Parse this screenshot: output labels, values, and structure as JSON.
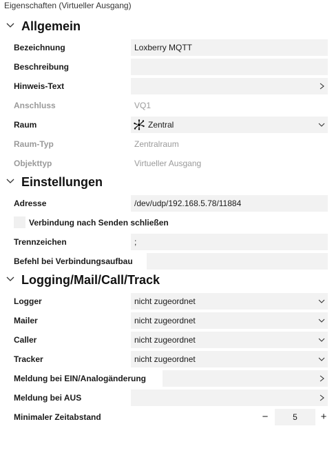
{
  "window_title": "Eigenschaften (Virtueller Ausgang)",
  "sections": {
    "allgemein": "Allgemein",
    "einstellungen": "Einstellungen",
    "logging": "Logging/Mail/Call/Track"
  },
  "allgemein": {
    "bezeichnung": {
      "label": "Bezeichnung",
      "value": "Loxberry MQTT"
    },
    "beschreibung": {
      "label": "Beschreibung",
      "value": ""
    },
    "hinweis": {
      "label": "Hinweis-Text",
      "value": ""
    },
    "anschluss": {
      "label": "Anschluss",
      "value": "VQ1"
    },
    "raum": {
      "label": "Raum",
      "value": "Zentral",
      "icon": "central-room-icon"
    },
    "raumtyp": {
      "label": "Raum-Typ",
      "value": "Zentralraum"
    },
    "objekttyp": {
      "label": "Objekttyp",
      "value": "Virtueller Ausgang"
    }
  },
  "einstellungen": {
    "adresse": {
      "label": "Adresse",
      "value": "/dev/udp/192.168.5.78/11884"
    },
    "verbindung": {
      "label": "Verbindung nach Senden schließen",
      "checked": false
    },
    "trennzeichen": {
      "label": "Trennzeichen",
      "value": ";"
    },
    "befehl": {
      "label": "Befehl bei Verbindungsaufbau",
      "value": ""
    }
  },
  "logging": {
    "logger": {
      "label": "Logger",
      "value": "nicht zugeordnet"
    },
    "mailer": {
      "label": "Mailer",
      "value": "nicht zugeordnet"
    },
    "caller": {
      "label": "Caller",
      "value": "nicht zugeordnet"
    },
    "tracker": {
      "label": "Tracker",
      "value": "nicht zugeordnet"
    },
    "meldung_ein": {
      "label": "Meldung bei EIN/Analogänderung",
      "value": ""
    },
    "meldung_aus": {
      "label": "Meldung bei AUS",
      "value": ""
    },
    "zeitabstand": {
      "label": "Minimaler Zeitabstand",
      "value": "5",
      "minus": "−",
      "plus": "+"
    }
  }
}
